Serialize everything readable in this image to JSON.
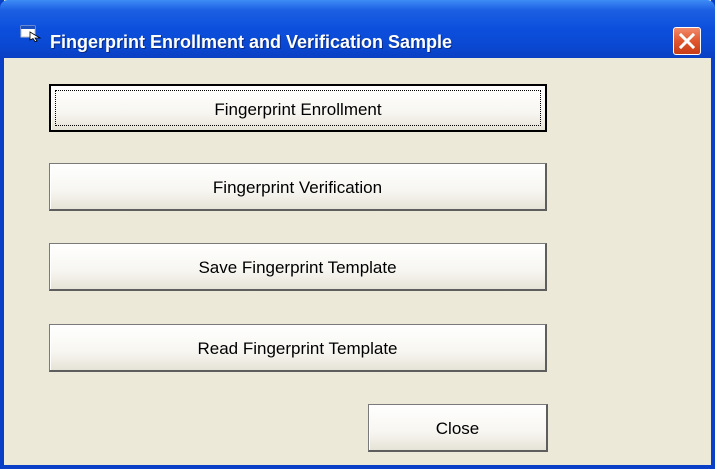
{
  "window": {
    "title": "Fingerprint Enrollment and Verification Sample",
    "app_icon": "app-window-icon",
    "close_icon": "close-x-icon"
  },
  "buttons": {
    "enrollment": "Fingerprint Enrollment",
    "verification": "Fingerprint Verification",
    "save_template": "Save Fingerprint Template",
    "read_template": "Read Fingerprint Template",
    "close": "Close"
  },
  "colors": {
    "titlebar": "#0a48d2",
    "face": "#ece9d8",
    "close_button": "#e0562e"
  }
}
